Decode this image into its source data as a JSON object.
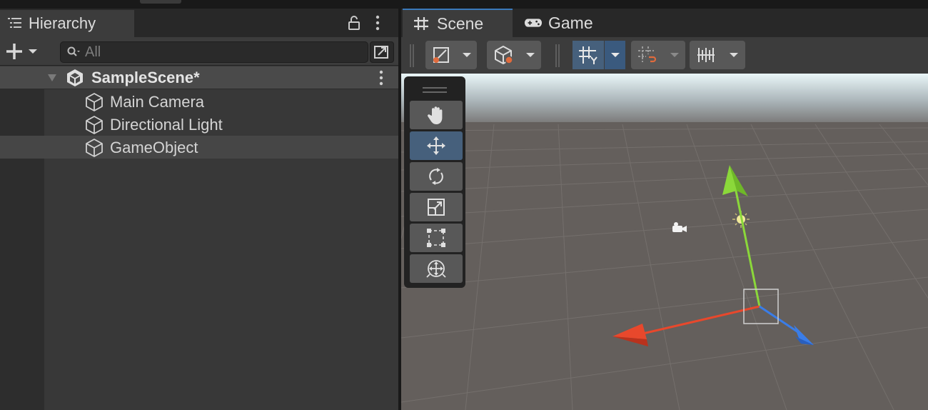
{
  "hierarchy": {
    "tab_label": "Hierarchy",
    "search_placeholder": "All",
    "scene": {
      "name": "SampleScene*"
    },
    "items": [
      {
        "label": "Main Camera",
        "selected": false
      },
      {
        "label": "Directional Light",
        "selected": false
      },
      {
        "label": "GameObject",
        "selected": true
      }
    ]
  },
  "scene_view": {
    "tabs": [
      {
        "label": "Scene",
        "icon": "grid-hash-icon",
        "active": true
      },
      {
        "label": "Game",
        "icon": "gamepad-icon",
        "active": false
      }
    ],
    "toolbar": [
      "draw-mode",
      "render-mode",
      "grid-snap-toggle",
      "increment-snap",
      "grid-visibility"
    ],
    "tools": [
      {
        "name": "hand-tool",
        "icon": "hand-icon",
        "active": false
      },
      {
        "name": "move-tool",
        "icon": "move-arrows-icon",
        "active": true
      },
      {
        "name": "rotate-tool",
        "icon": "rotate-icon",
        "active": false
      },
      {
        "name": "scale-tool",
        "icon": "scale-icon",
        "active": false
      },
      {
        "name": "rect-tool",
        "icon": "rect-transform-icon",
        "active": false
      },
      {
        "name": "transform-tool",
        "icon": "transform-icon",
        "active": false
      }
    ]
  },
  "colors": {
    "accent_blue": "#3a79bb",
    "active_tool": "#46607c",
    "gizmo_x": "#e8482c",
    "gizmo_y": "#8bd83a",
    "gizmo_z": "#3a7de8"
  }
}
